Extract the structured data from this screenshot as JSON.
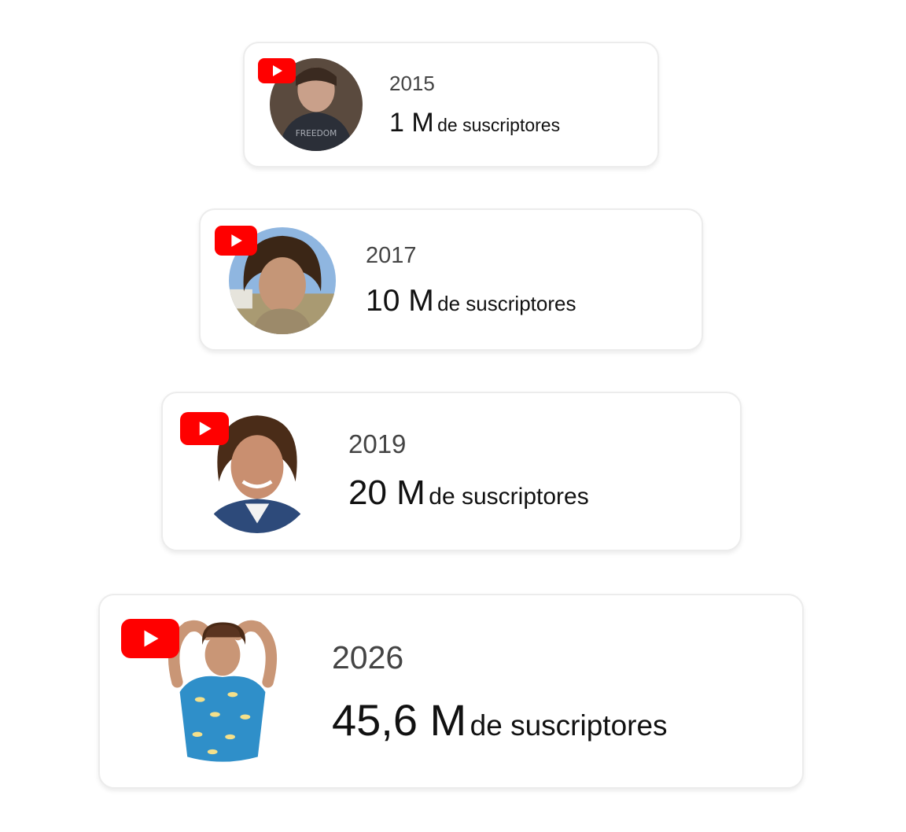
{
  "milestones": [
    {
      "year": "2015",
      "count": "1 M",
      "suffix": "de suscriptores"
    },
    {
      "year": "2017",
      "count": "10 M",
      "suffix": "de suscriptores"
    },
    {
      "year": "2019",
      "count": "20 M",
      "suffix": "de suscriptores"
    },
    {
      "year": "2026",
      "count": "45,6 M",
      "suffix": "de suscriptores"
    }
  ],
  "icons": {
    "badge": "youtube-logo-icon"
  },
  "colors": {
    "youtube_red": "#ff0000",
    "year_text": "#444444",
    "count_text": "#111111",
    "card_border": "#ececec"
  }
}
